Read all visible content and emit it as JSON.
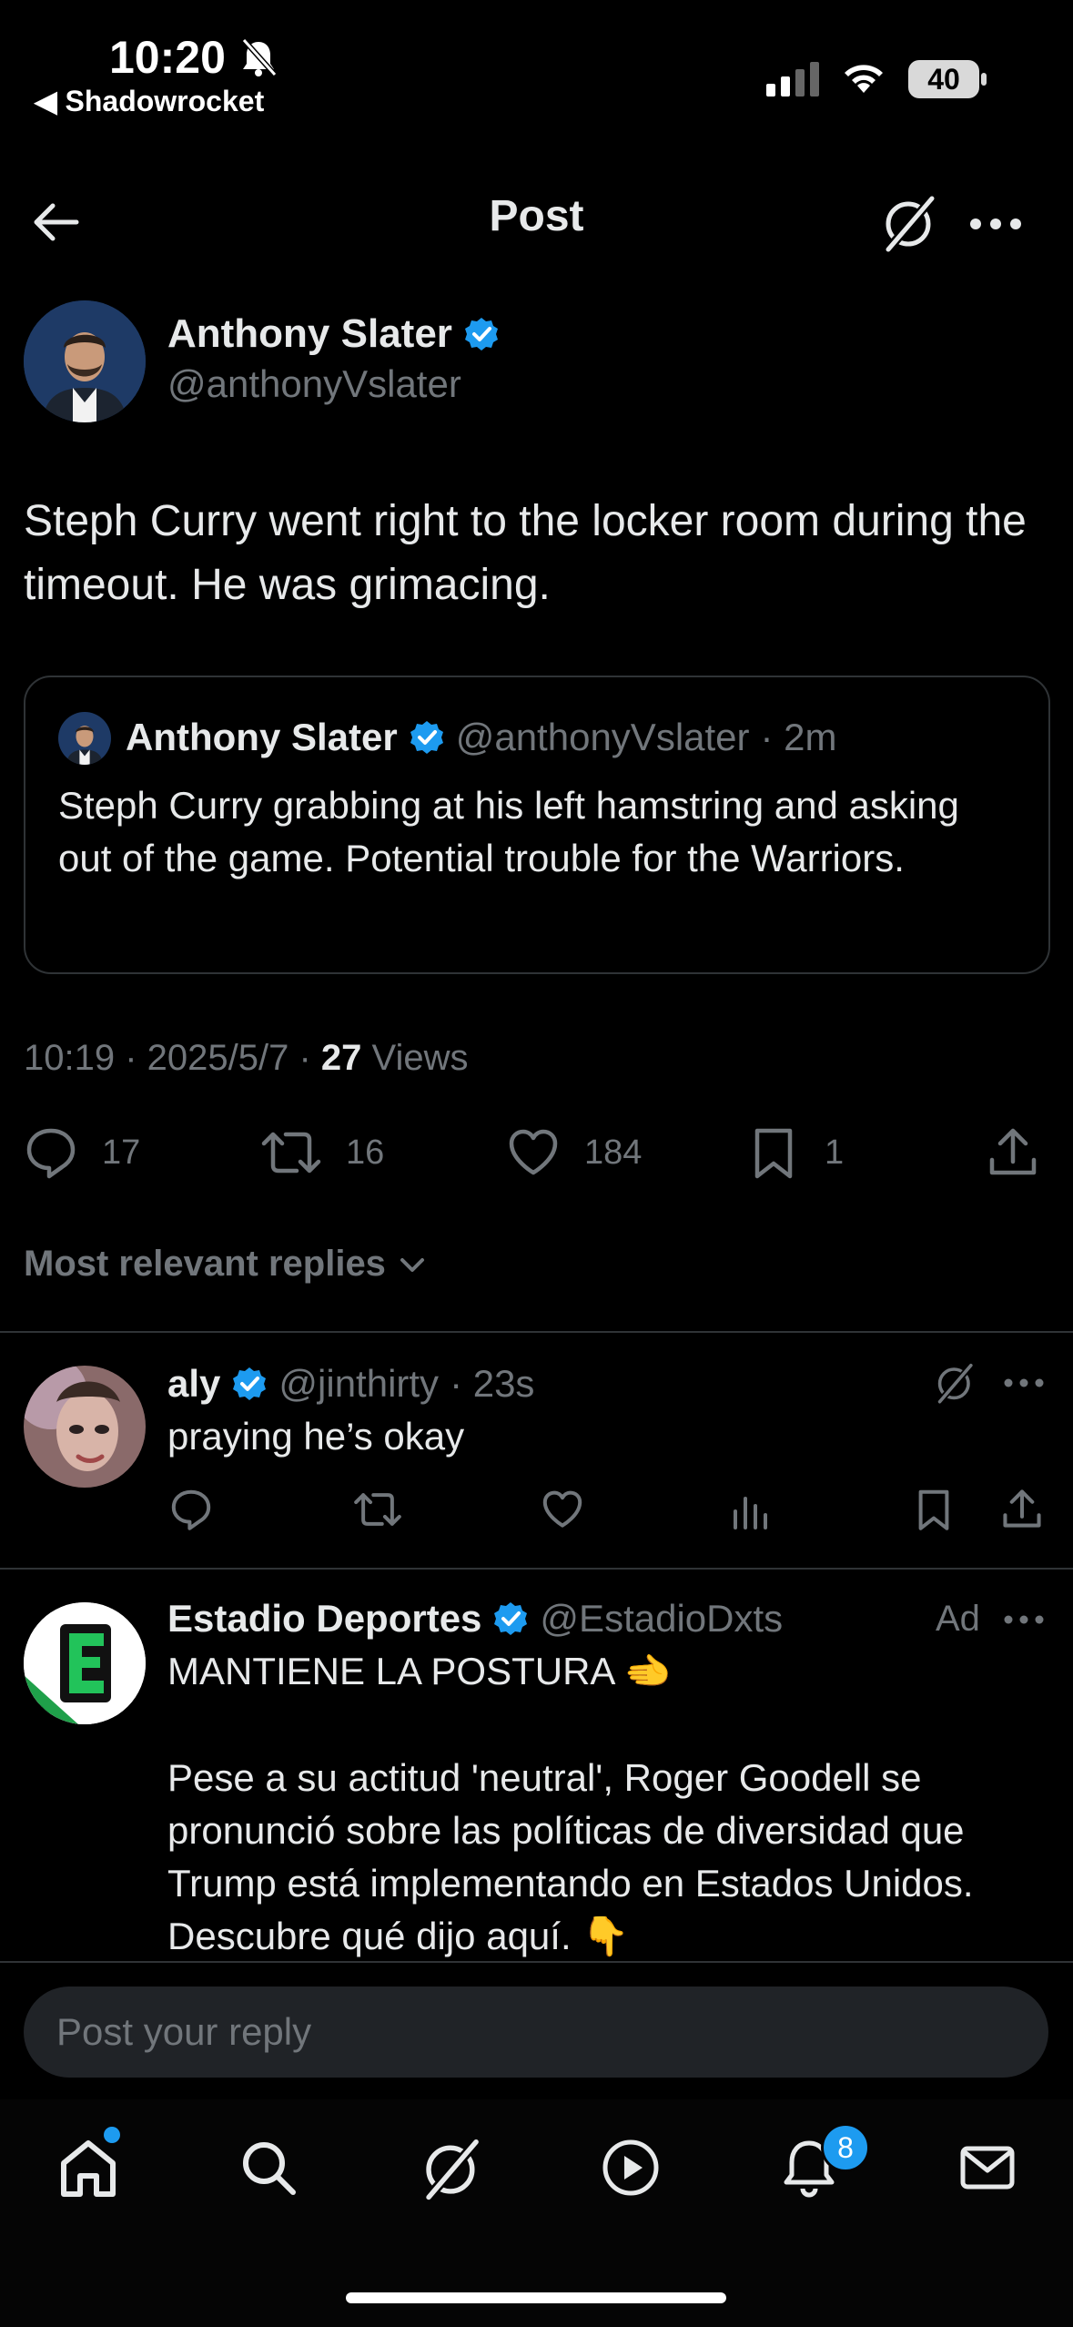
{
  "status_bar": {
    "time": "10:20",
    "back_app": "◀ Shadowrocket",
    "battery": "40"
  },
  "header": {
    "title": "Post"
  },
  "post": {
    "author_name": "Anthony Slater",
    "author_handle": "@anthonyVslater",
    "text": "Steph Curry went right to the locker room during the timeout. He was grimacing.",
    "quote": {
      "author_name": "Anthony Slater",
      "author_handle": "@anthonyVslater",
      "time": "· 2m",
      "text": "Steph Curry grabbing at his left hamstring and asking out of the game. Potential trouble for the Warriors."
    },
    "meta_time": "10:19 · 2025/5/7 · ",
    "views_count": "27",
    "views_label": " Views",
    "stats": {
      "replies": "17",
      "reposts": "16",
      "likes": "184",
      "bookmarks": "1"
    }
  },
  "replies_filter": {
    "label": "Most relevant replies"
  },
  "reply": {
    "author_name": "aly",
    "author_handle": "@jinthirty",
    "time": "· 23s",
    "text": "praying he’s okay"
  },
  "ad": {
    "author_name": "Estadio Deportes",
    "author_handle": "@EstadioDxts",
    "ad_label": "Ad",
    "line1": "MANTIENE LA POSTURA 🫲",
    "body": "Pese a su actitud 'neutral', Roger Goodell se pronunció sobre las políticas de diversidad que Trump está implementando en Estados Unidos. Descubre qué dijo aquí.  👇"
  },
  "composer": {
    "placeholder": "Post your reply"
  },
  "nav": {
    "notifications_badge": "8"
  },
  "colors": {
    "accent": "#1d9bf0",
    "background": "#000000",
    "muted": "#71767b"
  }
}
